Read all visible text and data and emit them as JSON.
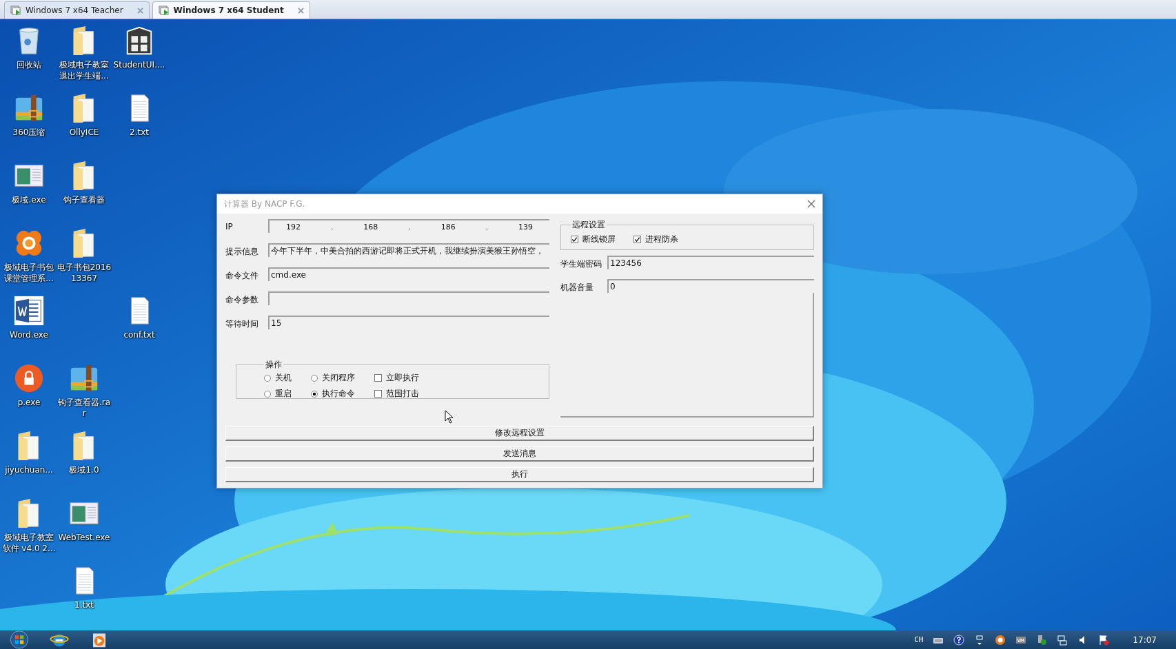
{
  "tabs": [
    {
      "label": "Windows 7 x64 Teacher",
      "selected": false
    },
    {
      "label": "Windows 7 x64 Student",
      "selected": true
    }
  ],
  "desktop_icons": [
    {
      "label": "回收站",
      "kind": "recycle"
    },
    {
      "label": "极域电子教室退出学生端...",
      "kind": "folder"
    },
    {
      "label": "StudentUI....",
      "kind": "grid"
    },
    {
      "label": "360压缩",
      "kind": "zip"
    },
    {
      "label": "OllyICE",
      "kind": "folder"
    },
    {
      "label": "2.txt",
      "kind": "text"
    },
    {
      "label": "极域.exe",
      "kind": "app"
    },
    {
      "label": "钩子查看器",
      "kind": "folder"
    },
    {
      "label": "极域电子书包课堂管理系...",
      "kind": "flower"
    },
    {
      "label": "电子书包201613367",
      "kind": "folder"
    },
    {
      "label": "Word.exe",
      "kind": "word"
    },
    {
      "label": "conf.txt",
      "kind": "text"
    },
    {
      "label": "p.exe",
      "kind": "lock"
    },
    {
      "label": "钩子查看器.rar",
      "kind": "zip"
    },
    {
      "label": "jiyuchuan...",
      "kind": "folder"
    },
    {
      "label": "极域1.0",
      "kind": "folder"
    },
    {
      "label": "极域电子教室软件 v4.0 2...",
      "kind": "folder"
    },
    {
      "label": "WebTest.exe",
      "kind": "app"
    },
    {
      "label": "1.txt",
      "kind": "text"
    }
  ],
  "dialog": {
    "title": "计算器 By NACP F.G.",
    "ip": {
      "label": "IP",
      "octets": [
        "192",
        "168",
        "186",
        "139"
      ],
      "separator": "."
    },
    "fields": [
      {
        "label": "提示信息",
        "value": "今年下半年，中美合拍的西游记即将正式开机，我继续扮演美猴王孙悟空，"
      },
      {
        "label": "命令文件",
        "value": "cmd.exe"
      },
      {
        "label": "命令参数"
      },
      {
        "label": "等待时间",
        "value": "15"
      }
    ],
    "operation": {
      "legend": "操作",
      "options": [
        {
          "kind": "radio",
          "label": "关机",
          "selected": false
        },
        {
          "kind": "radio",
          "label": "关闭程序",
          "selected": false
        },
        {
          "kind": "checkbox",
          "label": "立即执行",
          "checked": false
        },
        {
          "kind": "radio",
          "label": "重启",
          "selected": false
        },
        {
          "kind": "radio",
          "label": "执行命令",
          "selected": true
        },
        {
          "kind": "checkbox",
          "label": "范围打击",
          "checked": false
        }
      ]
    },
    "remote": {
      "legend": "远程设置",
      "checks": [
        {
          "label": "断线锁屏",
          "checked": true
        },
        {
          "label": "进程防杀",
          "checked": true
        }
      ],
      "fields": [
        {
          "label": "学生端密码",
          "value": "123456"
        },
        {
          "label": "机器音量",
          "value": "0"
        }
      ]
    },
    "buttons": [
      "修改远程设置",
      "发送消息",
      "执行"
    ]
  },
  "taskbar": {
    "language": "CH",
    "time": "17:07"
  }
}
